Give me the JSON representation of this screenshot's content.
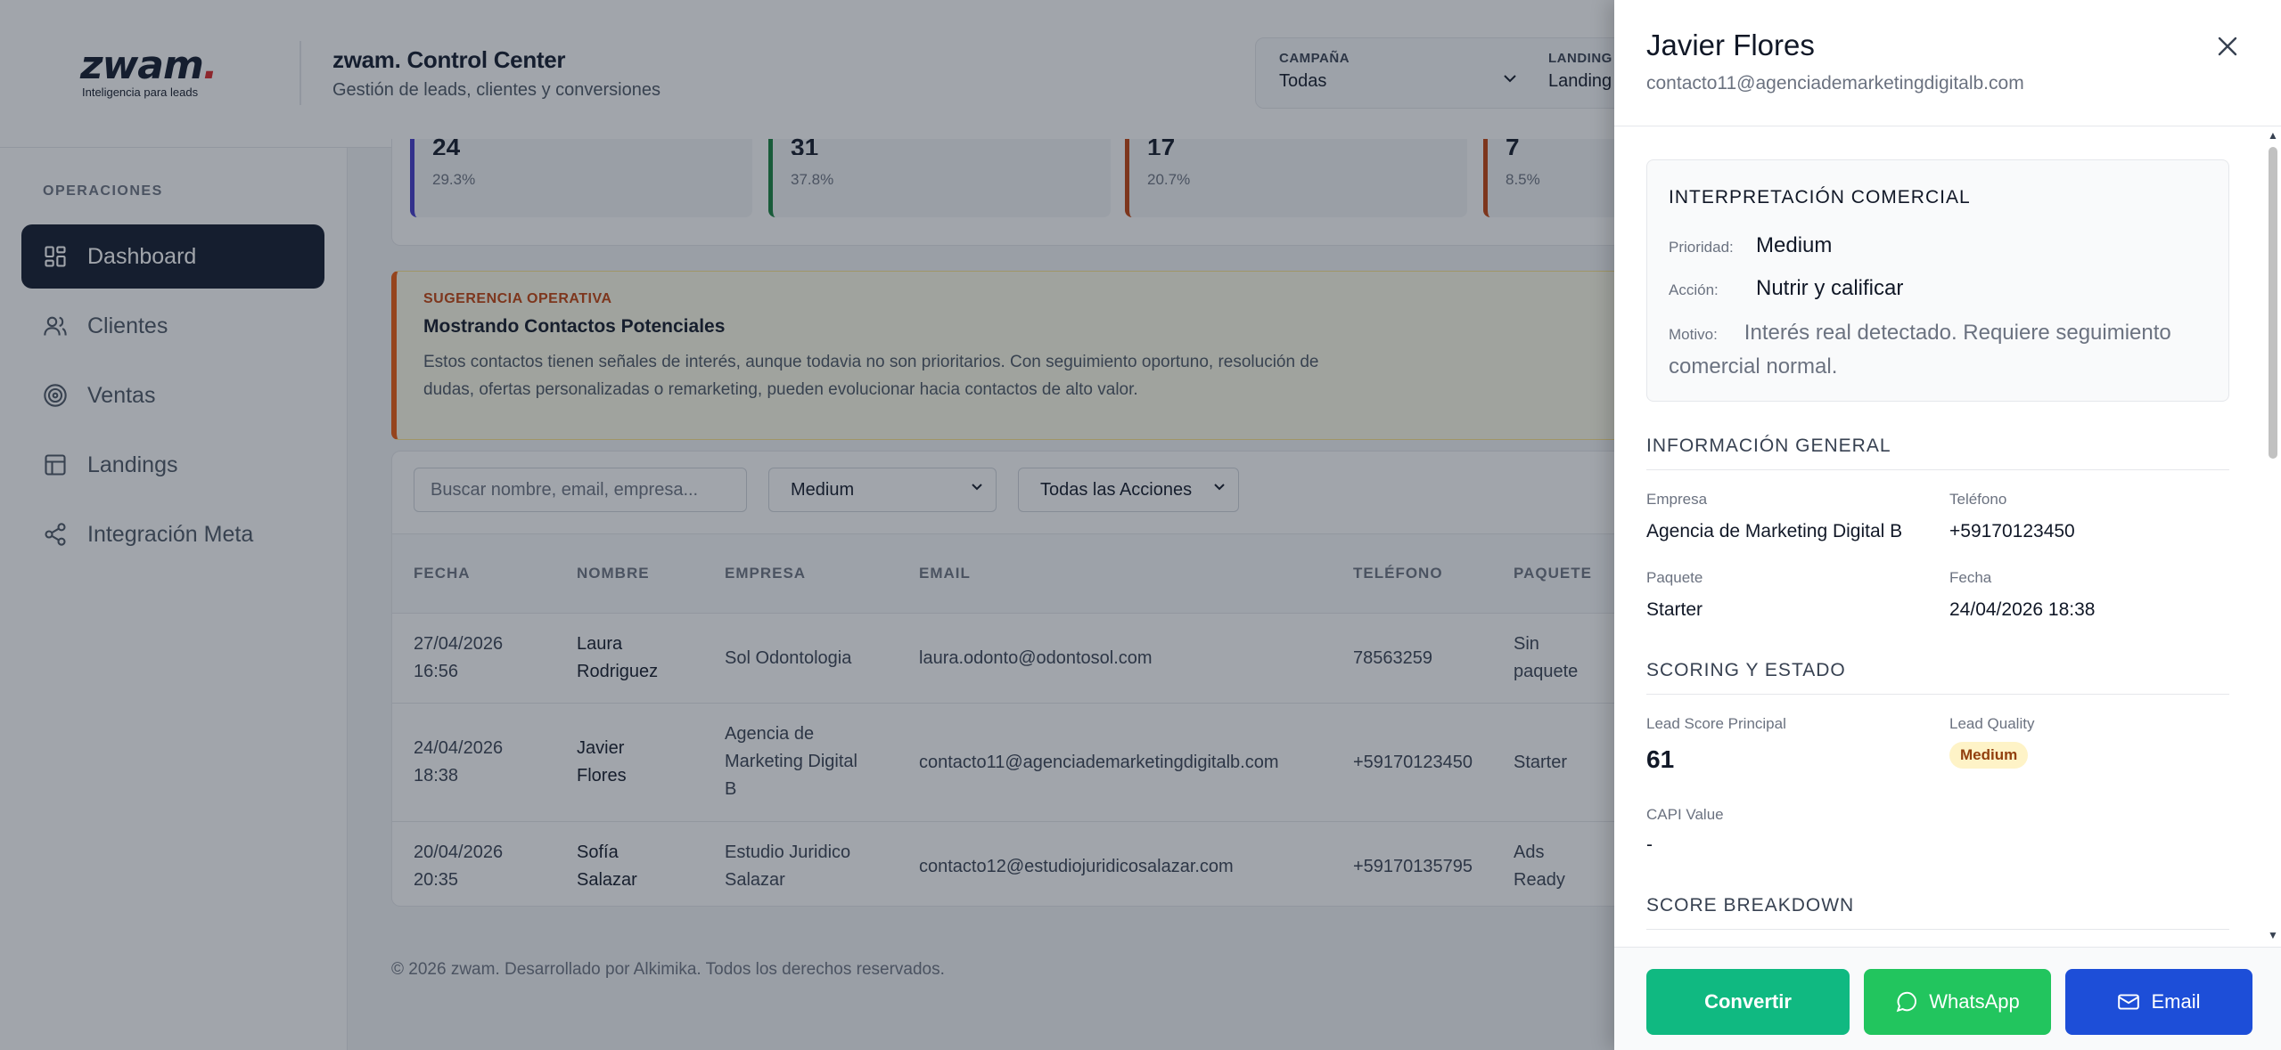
{
  "header": {
    "logo": "zwam",
    "logo_dot": ".",
    "logo_tagline": "Inteligencia para leads",
    "title": "zwam. Control Center",
    "subtitle": "Gestión de leads, clientes y conversiones",
    "filters": [
      {
        "label": "CAMPAÑA",
        "value": "Todas"
      },
      {
        "label": "LANDING",
        "value": "Landing"
      }
    ]
  },
  "sidebar": {
    "section": "OPERACIONES",
    "items": [
      {
        "label": "Dashboard",
        "icon": "dashboard-icon",
        "active": true
      },
      {
        "label": "Clientes",
        "icon": "users-icon"
      },
      {
        "label": "Ventas",
        "icon": "target-icon"
      },
      {
        "label": "Landings",
        "icon": "layout-icon"
      },
      {
        "label": "Integración Meta",
        "icon": "share-icon"
      }
    ]
  },
  "stats": [
    {
      "number": "24",
      "percent": "29.3%",
      "color": "#4338ca"
    },
    {
      "number": "31",
      "percent": "37.8%",
      "color": "#15803d"
    },
    {
      "number": "17",
      "percent": "20.7%",
      "color": "#c2410c"
    },
    {
      "number": "7",
      "percent": "8.5%",
      "color": "#c2410c"
    }
  ],
  "suggestion": {
    "label": "SUGERENCIA OPERATIVA",
    "title": "Mostrando Contactos Potenciales",
    "text": "Estos contactos tienen señales de interés, aunque todavia no son prioritarios. Con seguimiento oportuno, resolución de dudas, ofertas personalizadas o remarketing, pueden evolucionar hacia contactos de alto valor."
  },
  "table": {
    "search_placeholder": "Buscar nombre, email, empresa...",
    "quality_filter": "Medium",
    "action_filter": "Todas las Acciones",
    "columns": [
      "FECHA",
      "NOMBRE",
      "EMPRESA",
      "EMAIL",
      "TELÉFONO",
      "PAQUETE"
    ],
    "rows": [
      {
        "fecha": "27/04/2026\n16:56",
        "nombre": "Laura\nRodriguez",
        "empresa": "Sol Odontologia",
        "email": "laura.odonto@odontosol.com",
        "telefono": "78563259",
        "paquete": "Sin\npaquete"
      },
      {
        "fecha": "24/04/2026\n18:38",
        "nombre": "Javier\nFlores",
        "empresa": "Agencia de\nMarketing Digital\nB",
        "email": "contacto11@agenciademarketingdigitalb.com",
        "telefono": "+59170123450",
        "paquete": "Starter"
      },
      {
        "fecha": "20/04/2026\n20:35",
        "nombre": "Sofía\nSalazar",
        "empresa": "Estudio Juridico\nSalazar",
        "email": "contacto12@estudiojuridicosalazar.com",
        "telefono": "+59170135795",
        "paquete": "Ads\nReady"
      }
    ]
  },
  "footer": "© 2026 zwam. Desarrollado por Alkimika. Todos los derechos reservados.",
  "drawer": {
    "name": "Javier Flores",
    "email": "contacto11@agenciademarketingdigitalb.com",
    "interpretation": {
      "title": "INTERPRETACIÓN COMERCIAL",
      "prioridad_label": "Prioridad:",
      "prioridad": "Medium",
      "accion_label": "Acción:",
      "accion": "Nutrir y calificar",
      "motivo_label": "Motivo:",
      "motivo": "Interés real detectado. Requiere seguimiento comercial normal."
    },
    "general": {
      "title": "INFORMACIÓN GENERAL",
      "empresa_label": "Empresa",
      "empresa": "Agencia de Marketing Digital B",
      "telefono_label": "Teléfono",
      "telefono": "+59170123450",
      "paquete_label": "Paquete",
      "paquete": "Starter",
      "fecha_label": "Fecha",
      "fecha": "24/04/2026 18:38"
    },
    "scoring": {
      "title": "SCORING Y ESTADO",
      "lead_score_label": "Lead Score Principal",
      "lead_score": "61",
      "lead_quality_label": "Lead Quality",
      "lead_quality": "Medium",
      "capi_label": "CAPI Value",
      "capi": "-"
    },
    "breakdown_title": "SCORE BREAKDOWN",
    "buttons": {
      "convert": "Convertir",
      "whatsapp": "WhatsApp",
      "email": "Email"
    },
    "colors": {
      "convert": "#10b981",
      "whatsapp": "#22c55e",
      "email": "#1d4ed8"
    }
  }
}
